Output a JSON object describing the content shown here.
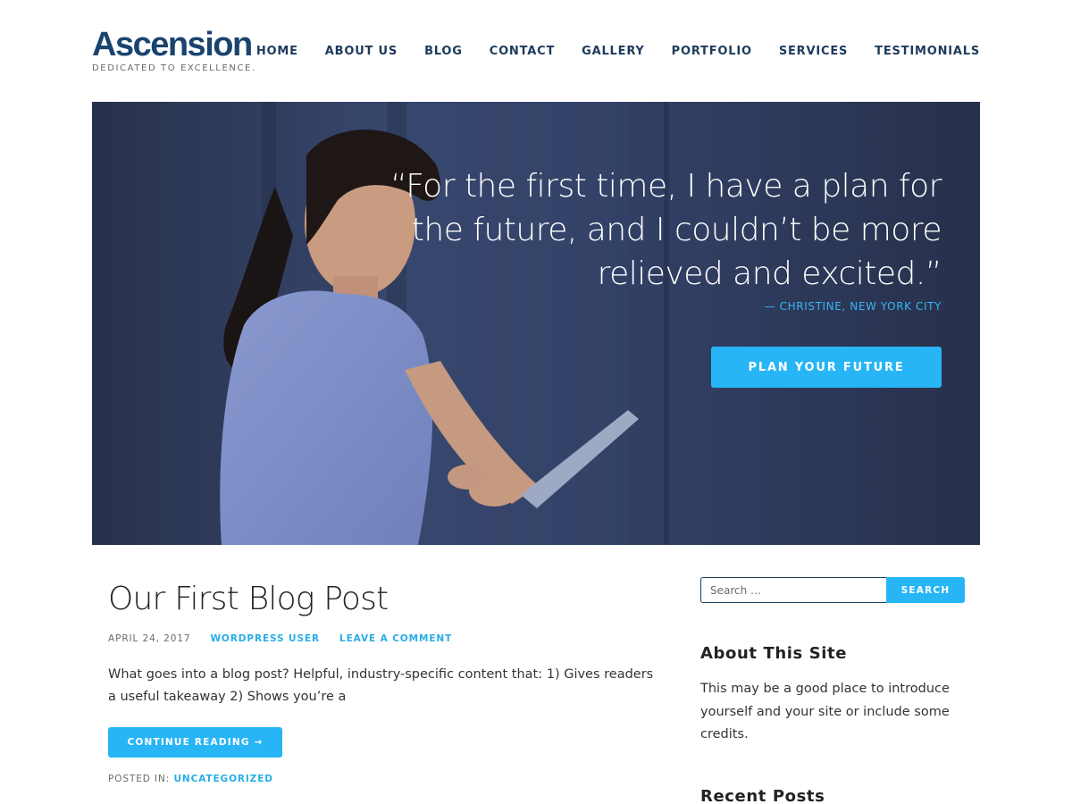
{
  "site": {
    "title": "Ascension",
    "tagline": "DEDICATED TO EXCELLENCE."
  },
  "nav": {
    "items": [
      {
        "label": "HOME"
      },
      {
        "label": "ABOUT US"
      },
      {
        "label": "BLOG"
      },
      {
        "label": "CONTACT"
      },
      {
        "label": "GALLERY"
      },
      {
        "label": "PORTFOLIO"
      },
      {
        "label": "SERVICES"
      },
      {
        "label": "TESTIMONIALS"
      }
    ]
  },
  "hero": {
    "quote": "“For the first time, I have a plan for the future, and I couldn’t be more relieved and excited.”",
    "attribution": "— CHRISTINE, NEW YORK CITY",
    "cta_label": "PLAN YOUR FUTURE"
  },
  "post": {
    "title": "Our First Blog Post",
    "date": "APRIL 24, 2017",
    "author": "WORDPRESS USER",
    "comment_link": "LEAVE A COMMENT",
    "excerpt": "What goes into a blog post? Helpful, industry-specific content that: 1) Gives readers a useful takeaway 2) Shows you’re a",
    "read_more": "CONTINUE READING →",
    "posted_in_label": "POSTED IN:",
    "category": "UNCATEGORIZED"
  },
  "sidebar": {
    "search_placeholder": "Search …",
    "search_button": "SEARCH",
    "about_title": "About This Site",
    "about_text": "This may be a good place to introduce yourself and your site or include some credits.",
    "recent_title": "Recent Posts"
  },
  "colors": {
    "brand": "#1a4470",
    "accent": "#27b5f5",
    "nav_text": "#1d3b5c"
  }
}
